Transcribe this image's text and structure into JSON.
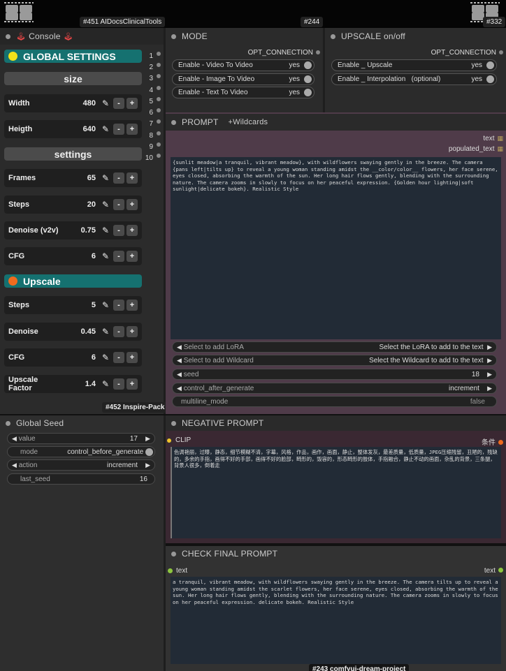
{
  "top": {
    "tag_451": "#451 AIDocsClinicalTools",
    "tag_244": "#244",
    "tag_332": "#332"
  },
  "console": {
    "title": "Console",
    "global_settings": "GLOBAL SETTINGS",
    "size_label": "size",
    "settings_label": "settings",
    "rows": [
      {
        "label": "Width",
        "value": "480"
      },
      {
        "label": "Heigth",
        "value": "640"
      },
      {
        "label": "Frames",
        "value": "65"
      },
      {
        "label": "Steps",
        "value": "20"
      },
      {
        "label": "Denoise (v2v)",
        "value": "0.75"
      },
      {
        "label": "CFG",
        "value": "6"
      }
    ],
    "upscale_label": "Upscale",
    "upscale_rows": [
      {
        "label": "Steps",
        "value": "5"
      },
      {
        "label": "Denoise",
        "value": "0.45"
      },
      {
        "label": "CFG",
        "value": "6"
      },
      {
        "label": "Upscale Factor",
        "value": "1.4"
      }
    ],
    "numbers": [
      "1",
      "2",
      "3",
      "4",
      "5",
      "6",
      "7",
      "8",
      "9",
      "10"
    ],
    "footer_tag": "#452 Inspire-Pack",
    "colors": {
      "yellow": "#f2e21a",
      "orange": "#ef6b1e",
      "teal": "#157170"
    }
  },
  "mode": {
    "title": "MODE",
    "opt": "OPT_CONNECTION",
    "toggles": [
      {
        "label": "Enable - Video To Video",
        "value": "yes"
      },
      {
        "label": "Enable - Image To Video",
        "value": "yes"
      },
      {
        "label": "Enable - Text To Video",
        "value": "yes"
      }
    ]
  },
  "upscale": {
    "title": "UPSCALE on/off",
    "opt": "OPT_CONNECTION",
    "toggles": [
      {
        "label": "Enable _ Upscale",
        "value": "yes"
      },
      {
        "label": "Enable _ Interpolation   (optional)",
        "value": "yes"
      }
    ]
  },
  "prompt": {
    "title": "PROMPT",
    "subtitle": "+Wildcards",
    "out_text": "text",
    "out_populated": "populated_text",
    "text": "{sunlit meadow|a tranquil, vibrant meadow}, with wildflowers swaying gently in the breeze. The camera {pans left|tilts up} to reveal a young woman standing amidst the __color/color__ flowers, her face serene, eyes closed, absorbing the warmth of the sun. Her long hair flows gently, blending with the surrounding nature. The camera zooms in slowly to focus on her peaceful expression. {Golden hour lighting|soft sunlight|delicate bokeh}. Realistic Style",
    "lora_left": "Select to add LoRA",
    "lora_right": "Select the LoRA to add to the text",
    "wild_left": "Select to add Wildcard",
    "wild_right": "Select the Wildcard to add to the text",
    "seed_label": "seed",
    "seed_value": "18",
    "cag_label": "control_after_generate",
    "cag_value": "increment",
    "mm_label": "multiline_mode",
    "mm_value": "false"
  },
  "global_seed": {
    "title": "Global Seed",
    "value_label": "value",
    "value": "17",
    "mode_label": "mode",
    "mode_value": "control_before_generate",
    "action_label": "action",
    "action_value": "increment",
    "last_label": "last_seed",
    "last_value": "16"
  },
  "negative": {
    "title": "NEGATIVE PROMPT",
    "clip": "CLIP",
    "out": "条件",
    "text": "色调艳丽，过曝，静态，细节模糊不清，字幕，风格，作品，画作，画面，静止，整体发灰，最差质量，低质量，JPEG压缩残留，丑陋的，残缺的，多余的手指，画得不好的手部，画得不好的脸部，畸形的，毁容的，形态畸形的肢体，手指融合，静止不动的画面，杂乱的背景，三条腿，背景人很多，倒着走"
  },
  "check": {
    "title": "CHECK FINAL PROMPT",
    "in_text": "text",
    "out_text": "text",
    "text": "a tranquil, vibrant meadow, with wildflowers swaying gently in the breeze. The camera tilts up to reveal a young woman standing amidst the scarlet flowers, her face serene, eyes closed, absorbing the warmth of the sun. Her long hair flows gently, blending with the surrounding nature. The camera zooms in slowly to focus on her peaceful expression. delicate bokeh. Realistic Style",
    "footer_tag": "#243 comfyui-dream-project"
  }
}
